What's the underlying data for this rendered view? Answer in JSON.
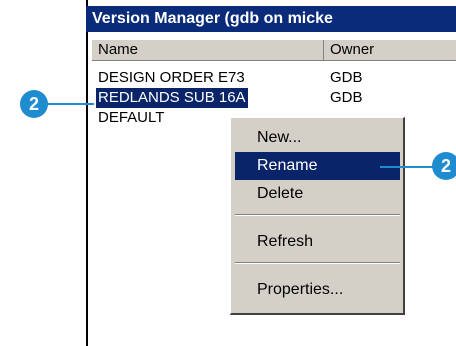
{
  "window": {
    "title": "Version Manager (gdb on micke"
  },
  "columns": {
    "name": "Name",
    "owner": "Owner"
  },
  "rows": [
    {
      "name": "DESIGN ORDER E73",
      "owner": "GDB"
    },
    {
      "name": "REDLANDS SUB 16A",
      "owner": "GDB"
    },
    {
      "name": "DEFAULT",
      "owner": ""
    }
  ],
  "context_menu": {
    "items": [
      "New...",
      "Rename",
      "Delete",
      "Refresh",
      "Properties..."
    ]
  },
  "callouts": {
    "left": "2",
    "right": "2"
  },
  "colors": {
    "callout": "#1f8ccf",
    "selection": "#0a246a",
    "titlebar": "#0a2a7a"
  }
}
